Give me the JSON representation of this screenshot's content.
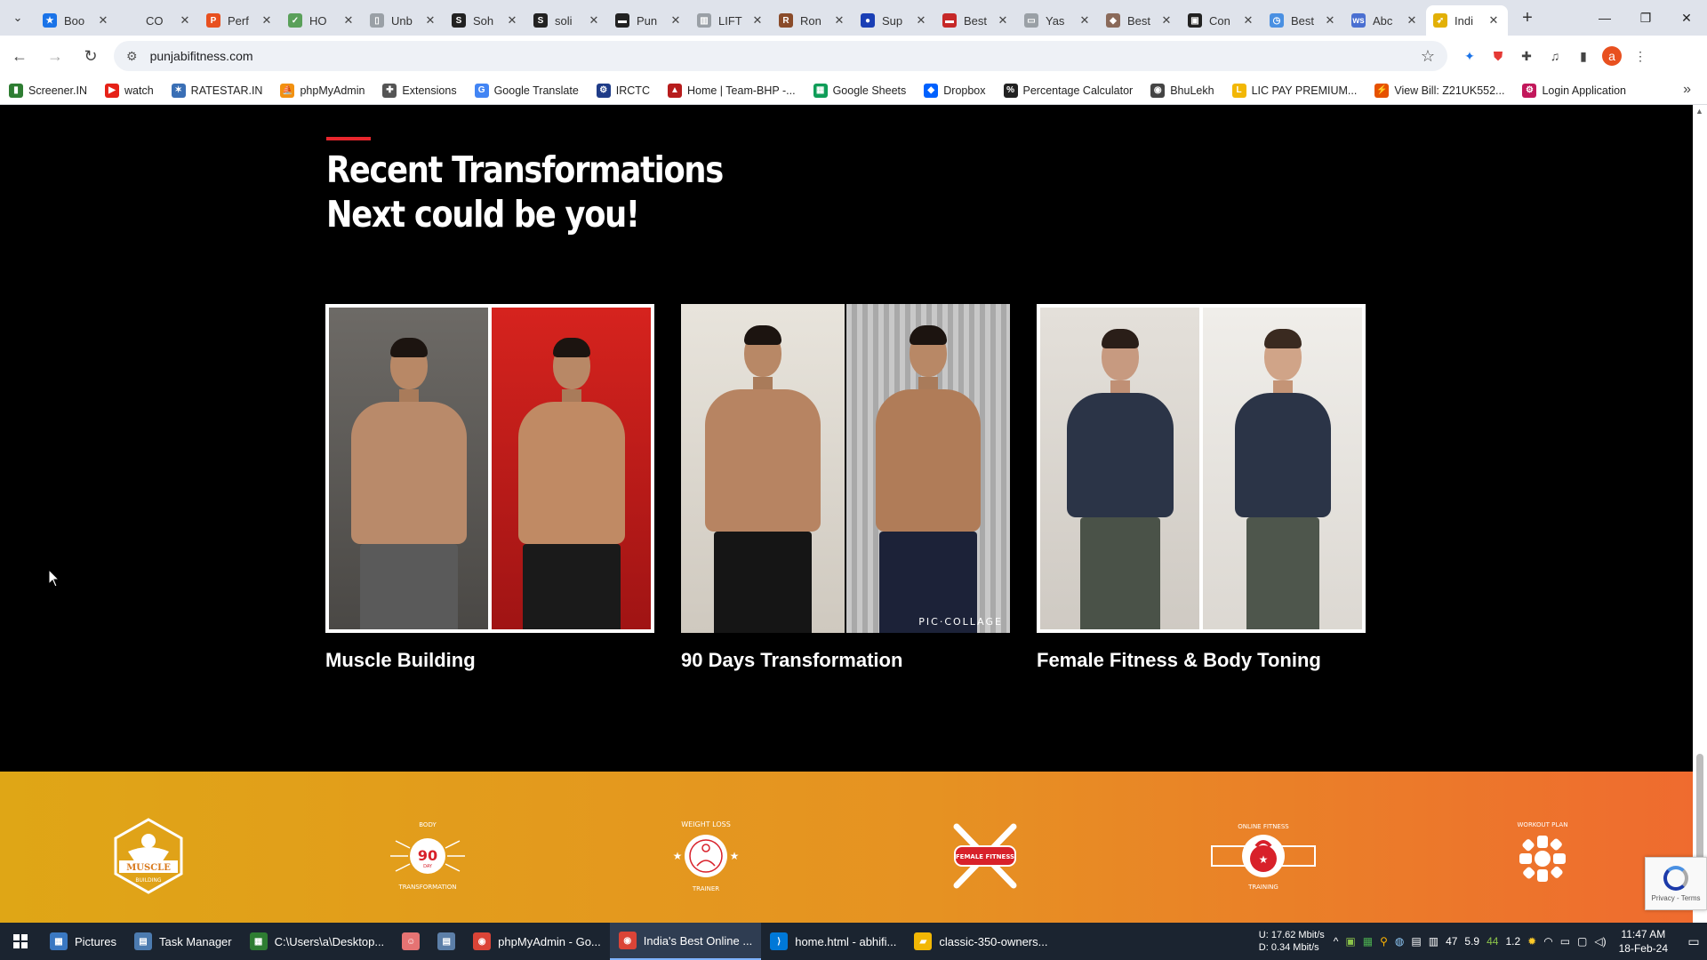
{
  "browser": {
    "tabs": [
      {
        "title": "Boo",
        "fav_color": "#1a73e8",
        "fav_glyph": "★"
      },
      {
        "title": "CO",
        "fav_color": "#dfe3eb",
        "fav_glyph": ""
      },
      {
        "title": "Perf",
        "fav_color": "#e8501f",
        "fav_glyph": "P"
      },
      {
        "title": "HO",
        "fav_color": "#5aa05a",
        "fav_glyph": "✓"
      },
      {
        "title": "Unb",
        "fav_color": "#9aa0a6",
        "fav_glyph": "▯"
      },
      {
        "title": "Soh",
        "fav_color": "#222222",
        "fav_glyph": "S"
      },
      {
        "title": "soli",
        "fav_color": "#222222",
        "fav_glyph": "S"
      },
      {
        "title": "Pun",
        "fav_color": "#222222",
        "fav_glyph": "▬"
      },
      {
        "title": "LIFT",
        "fav_color": "#9aa0a6",
        "fav_glyph": "▥"
      },
      {
        "title": "Ron",
        "fav_color": "#8a4b2a",
        "fav_glyph": "R"
      },
      {
        "title": "Sup",
        "fav_color": "#1a3fb5",
        "fav_glyph": "●"
      },
      {
        "title": "Best",
        "fav_color": "#c62828",
        "fav_glyph": "▬"
      },
      {
        "title": "Yas",
        "fav_color": "#9aa0a6",
        "fav_glyph": "▭"
      },
      {
        "title": "Best",
        "fav_color": "#8a6a5a",
        "fav_glyph": "◆"
      },
      {
        "title": "Con",
        "fav_color": "#222222",
        "fav_glyph": "▣"
      },
      {
        "title": "Best",
        "fav_color": "#4a90e2",
        "fav_glyph": "◷"
      },
      {
        "title": "Abc",
        "fav_color": "#4a6fd1",
        "fav_glyph": "ws"
      },
      {
        "title": "Indi",
        "fav_color": "#e2b007",
        "fav_glyph": "➶",
        "active": true
      }
    ],
    "url": "punjabifitness.com",
    "bookmarks": [
      {
        "label": "Screener.IN",
        "color": "#2e7d32",
        "glyph": "▮"
      },
      {
        "label": "watch",
        "color": "#e62117",
        "glyph": "▶"
      },
      {
        "label": "RATESTAR.IN",
        "color": "#3a6fb5",
        "glyph": "✶"
      },
      {
        "label": "phpMyAdmin",
        "color": "#f29111",
        "glyph": "⛵"
      },
      {
        "label": "Extensions",
        "color": "#555555",
        "glyph": "✚"
      },
      {
        "label": "Google Translate",
        "color": "#4285f4",
        "glyph": "G"
      },
      {
        "label": "IRCTC",
        "color": "#1f3c88",
        "glyph": "⚙"
      },
      {
        "label": "Home | Team-BHP -...",
        "color": "#b71c1c",
        "glyph": "▲"
      },
      {
        "label": "Google Sheets",
        "color": "#0f9d58",
        "glyph": "▦"
      },
      {
        "label": "Dropbox",
        "color": "#0061fe",
        "glyph": "◆"
      },
      {
        "label": "Percentage Calculator",
        "color": "#222222",
        "glyph": "%"
      },
      {
        "label": "BhuLekh",
        "color": "#444444",
        "glyph": "◉"
      },
      {
        "label": "LIC PAY PREMIUM...",
        "color": "#f2b705",
        "glyph": "L"
      },
      {
        "label": "View Bill: Z21UK552...",
        "color": "#e65100",
        "glyph": "⚡"
      },
      {
        "label": "Login Application",
        "color": "#c2185b",
        "glyph": "⚙"
      }
    ]
  },
  "page": {
    "heading_line1": "Recent Transformations",
    "heading_line2": "Next could be you!",
    "cards": [
      {
        "caption": "Muscle Building"
      },
      {
        "caption": "90 Days Transformation",
        "watermark": "PIC·COLLAGE"
      },
      {
        "caption": "Female Fitness & Body Toning"
      }
    ],
    "badges": [
      {
        "name": "muscle-building",
        "text_main": "MUSCLE",
        "text_sub": "BUILDING"
      },
      {
        "name": "90-day-transformation",
        "text_top": "BODY",
        "text_main": "90",
        "text_sub": "DAY",
        "text_bottom": "TRANSFORMATION"
      },
      {
        "name": "weight-loss-trainer",
        "text_top": "WEIGHT LOSS",
        "text_bottom": "TRAINER"
      },
      {
        "name": "female-fitness",
        "text_main": "FEMALE FITNESS"
      },
      {
        "name": "online-fitness-training",
        "text_top": "ONLINE FITNESS",
        "text_bottom": "TRAINING"
      },
      {
        "name": "workout-plan",
        "text_top": "WORKOUT PLAN"
      }
    ],
    "recaptcha_text": "Privacy - Terms"
  },
  "taskbar": {
    "items": [
      {
        "label": "Pictures",
        "color": "#3a78c2",
        "glyph": "▦"
      },
      {
        "label": "Task Manager",
        "color": "#4c7bb0",
        "glyph": "▤"
      },
      {
        "label": "C:\\Users\\a\\Desktop...",
        "color": "#2e7d32",
        "glyph": "▦"
      },
      {
        "label": "",
        "color": "#e57373",
        "glyph": "☺"
      },
      {
        "label": "",
        "color": "#5c7fa8",
        "glyph": "▤"
      },
      {
        "label": "phpMyAdmin - Go...",
        "color": "#db4437",
        "glyph": "◉"
      },
      {
        "label": "India's Best Online ...",
        "color": "#db4437",
        "glyph": "◉",
        "active": true
      },
      {
        "label": "home.html - abhifi...",
        "color": "#0078d7",
        "glyph": "⟩"
      },
      {
        "label": "classic-350-owners...",
        "color": "#f2b705",
        "glyph": "▰"
      }
    ],
    "net_up": "U:  17.62 Mbit/s",
    "net_down": "D:  0.34 Mbit/s",
    "tray_values": [
      "47",
      "5.9",
      "44",
      "1.2"
    ],
    "time": "11:47 AM",
    "date": "18-Feb-24"
  }
}
